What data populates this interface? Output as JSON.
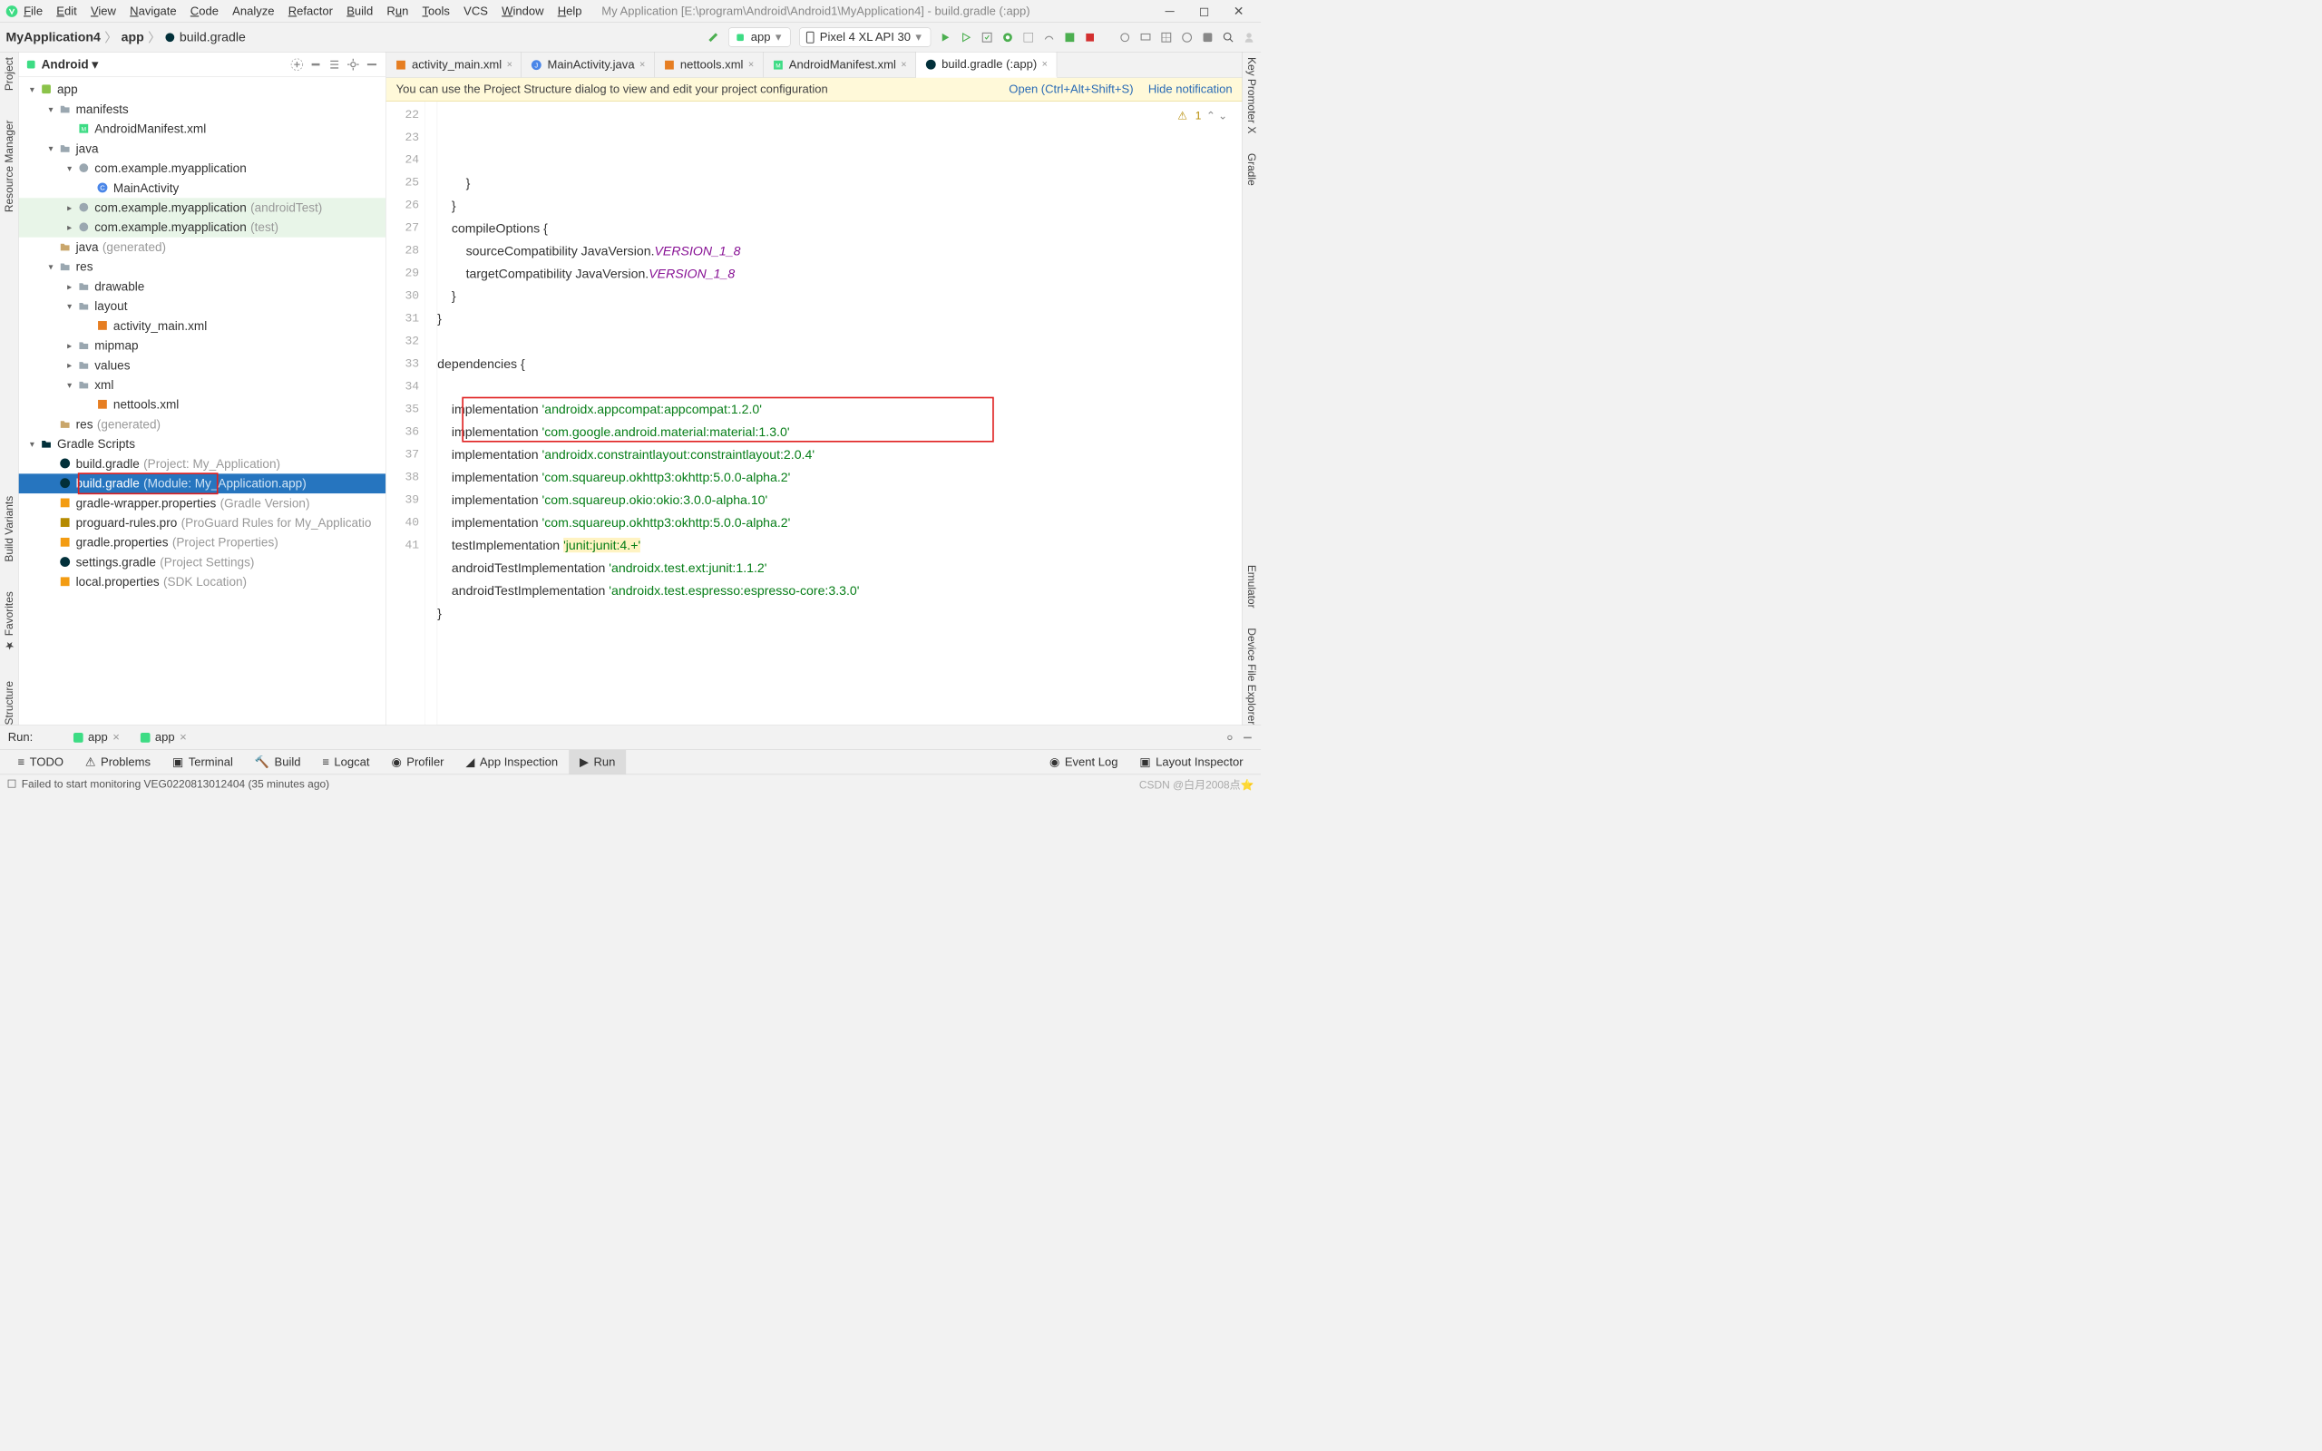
{
  "window": {
    "app_name": "My Application",
    "path": "[E:\\program\\Android\\Android1\\MyApplication4] - build.gradle (:app)"
  },
  "menu": {
    "file": "File",
    "edit": "Edit",
    "view": "View",
    "navigate": "Navigate",
    "code": "Code",
    "analyze": "Analyze",
    "refactor": "Refactor",
    "build": "Build",
    "run": "Run",
    "tools": "Tools",
    "vcs": "VCS",
    "window": "Window",
    "help": "Help"
  },
  "breadcrumbs": {
    "items": [
      "MyApplication4",
      "app",
      "build.gradle"
    ]
  },
  "run_config": {
    "label": "app"
  },
  "device": {
    "label": "Pixel 4 XL API 30"
  },
  "left_rail": {
    "items": [
      "Project",
      "Resource Manager"
    ]
  },
  "right_rail": {
    "items": [
      "Key Promoter X",
      "Gradle",
      "Emulator",
      "Device File Explorer"
    ]
  },
  "project_panel": {
    "title": "Android",
    "tree": [
      {
        "indent": 0,
        "expanded": true,
        "icon": "module",
        "label": "app"
      },
      {
        "indent": 1,
        "expanded": true,
        "icon": "folder",
        "label": "manifests"
      },
      {
        "indent": 2,
        "icon": "xml-m",
        "label": "AndroidManifest.xml"
      },
      {
        "indent": 1,
        "expanded": true,
        "icon": "folder",
        "label": "java"
      },
      {
        "indent": 2,
        "expanded": true,
        "icon": "package",
        "label": "com.example.myapplication"
      },
      {
        "indent": 3,
        "icon": "class",
        "label": "MainActivity"
      },
      {
        "indent": 2,
        "icon": "package",
        "label": "com.example.myapplication",
        "hint": "(androidTest)",
        "green": true
      },
      {
        "indent": 2,
        "icon": "package",
        "label": "com.example.myapplication",
        "hint": "(test)",
        "green": true
      },
      {
        "indent": 1,
        "icon": "folder-gen",
        "label": "java",
        "hint": "(generated)"
      },
      {
        "indent": 1,
        "expanded": true,
        "icon": "folder",
        "label": "res"
      },
      {
        "indent": 2,
        "icon": "folder",
        "label": "drawable"
      },
      {
        "indent": 2,
        "expanded": true,
        "icon": "folder",
        "label": "layout"
      },
      {
        "indent": 3,
        "icon": "xml",
        "label": "activity_main.xml"
      },
      {
        "indent": 2,
        "icon": "folder",
        "label": "mipmap"
      },
      {
        "indent": 2,
        "icon": "folder",
        "label": "values"
      },
      {
        "indent": 2,
        "expanded": true,
        "icon": "folder",
        "label": "xml"
      },
      {
        "indent": 3,
        "icon": "xml",
        "label": "nettools.xml"
      },
      {
        "indent": 1,
        "icon": "folder-gen",
        "label": "res",
        "hint": "(generated)"
      },
      {
        "indent": 0,
        "expanded": true,
        "icon": "gradle-folder",
        "label": "Gradle Scripts"
      },
      {
        "indent": 1,
        "icon": "gradle",
        "label": "build.gradle",
        "hint": "(Project: My_Application)"
      },
      {
        "indent": 1,
        "icon": "gradle",
        "label": "build.gradle",
        "hint": "(Module: My_Application.app)",
        "selected": true,
        "redbox": true
      },
      {
        "indent": 1,
        "icon": "prop",
        "label": "gradle-wrapper.properties",
        "hint": "(Gradle Version)"
      },
      {
        "indent": 1,
        "icon": "pro",
        "label": "proguard-rules.pro",
        "hint": "(ProGuard Rules for My_Applicatio"
      },
      {
        "indent": 1,
        "icon": "prop",
        "label": "gradle.properties",
        "hint": "(Project Properties)"
      },
      {
        "indent": 1,
        "icon": "gradle",
        "label": "settings.gradle",
        "hint": "(Project Settings)"
      },
      {
        "indent": 1,
        "icon": "prop",
        "label": "local.properties",
        "hint": "(SDK Location)"
      }
    ]
  },
  "editor": {
    "tabs": [
      {
        "icon": "xml",
        "label": "activity_main.xml"
      },
      {
        "icon": "java",
        "label": "MainActivity.java"
      },
      {
        "icon": "xml",
        "label": "nettools.xml"
      },
      {
        "icon": "xml-m",
        "label": "AndroidManifest.xml"
      },
      {
        "icon": "gradle",
        "label": "build.gradle (:app)",
        "active": true
      }
    ],
    "notif": {
      "msg": "You can use the Project Structure dialog to view and edit your project configuration",
      "open": "Open (Ctrl+Alt+Shift+S)",
      "hide": "Hide notification"
    },
    "warnings": "1",
    "first_line": 22,
    "lines": [
      {
        "n": 22,
        "segs": [
          {
            "t": "        }"
          }
        ]
      },
      {
        "n": 23,
        "segs": [
          {
            "t": "    }"
          }
        ]
      },
      {
        "n": 24,
        "segs": [
          {
            "t": "    compileOptions {"
          }
        ]
      },
      {
        "n": 25,
        "segs": [
          {
            "t": "        sourceCompatibility JavaVersion."
          },
          {
            "t": "VERSION_1_8",
            "c": "italic"
          }
        ]
      },
      {
        "n": 26,
        "segs": [
          {
            "t": "        targetCompatibility JavaVersion."
          },
          {
            "t": "VERSION_1_8",
            "c": "italic"
          }
        ]
      },
      {
        "n": 27,
        "segs": [
          {
            "t": "    }"
          }
        ]
      },
      {
        "n": 28,
        "segs": [
          {
            "t": "}"
          }
        ]
      },
      {
        "n": 29,
        "segs": [
          {
            "t": ""
          }
        ]
      },
      {
        "n": 30,
        "segs": [
          {
            "t": "dependencies {"
          }
        ]
      },
      {
        "n": 31,
        "segs": [
          {
            "t": ""
          }
        ]
      },
      {
        "n": 32,
        "segs": [
          {
            "t": "    implementation "
          },
          {
            "t": "'androidx.appcompat:appcompat:1.2.0'",
            "c": "str"
          }
        ]
      },
      {
        "n": 33,
        "segs": [
          {
            "t": "    implementation "
          },
          {
            "t": "'com.google.android.material:material:1.3.0'",
            "c": "str"
          }
        ]
      },
      {
        "n": 34,
        "segs": [
          {
            "t": "    implementation "
          },
          {
            "t": "'androidx.constraintlayout:constraintlayout:2.0.4'",
            "c": "str"
          }
        ]
      },
      {
        "n": 35,
        "segs": [
          {
            "t": "    implementation "
          },
          {
            "t": "'com.squareup.okhttp3:okhttp:5.0.0-alpha.2'",
            "c": "str"
          }
        ],
        "redstart": true
      },
      {
        "n": 36,
        "segs": [
          {
            "t": "    implementation "
          },
          {
            "t": "'com.squareup.okio:okio:3.0.0-alpha.10'",
            "c": "str"
          }
        ],
        "redend": true
      },
      {
        "n": 37,
        "segs": [
          {
            "t": "    implementation "
          },
          {
            "t": "'com.squareup.okhttp3:okhttp:5.0.0-alpha.2'",
            "c": "str"
          }
        ]
      },
      {
        "n": 38,
        "segs": [
          {
            "t": "    testImplementation "
          },
          {
            "t": "'junit:junit:4.+'",
            "c": "str hl"
          }
        ]
      },
      {
        "n": 39,
        "segs": [
          {
            "t": "    androidTestImplementation "
          },
          {
            "t": "'androidx.test.ext:junit:1.1.2'",
            "c": "str"
          }
        ]
      },
      {
        "n": 40,
        "segs": [
          {
            "t": "    androidTestImplementation "
          },
          {
            "t": "'androidx.test.espresso:espresso-core:3.3.0'",
            "c": "str"
          }
        ]
      },
      {
        "n": 41,
        "segs": [
          {
            "t": "}"
          }
        ]
      }
    ]
  },
  "run_panel": {
    "title": "Run:",
    "tabs": [
      "app",
      "app"
    ]
  },
  "bottom_tabs": {
    "items": [
      "TODO",
      "Problems",
      "Terminal",
      "Build",
      "Logcat",
      "Profiler",
      "App Inspection",
      "Run"
    ],
    "active": "Run",
    "right": [
      "Event Log",
      "Layout Inspector"
    ]
  },
  "status": {
    "msg": "Failed to start monitoring VEG0220813012404 (35 minutes ago)",
    "right": "CSDN @白月2008点⭐"
  }
}
